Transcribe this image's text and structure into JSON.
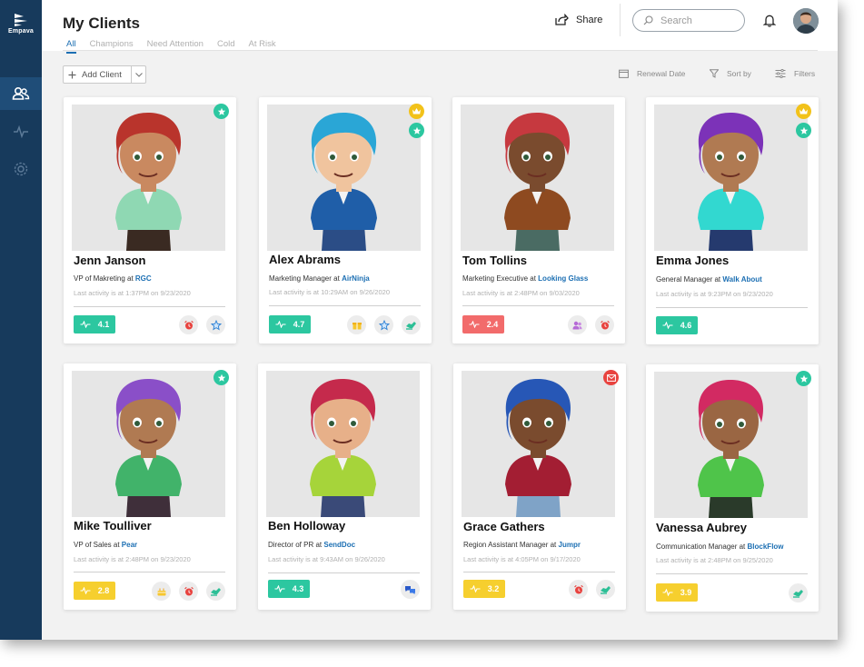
{
  "brand": {
    "name": "Empava"
  },
  "header": {
    "title": "My Clients",
    "tabs": [
      "All",
      "Champions",
      "Need Attention",
      "Cold",
      "At Risk"
    ],
    "share_label": "Share",
    "search_placeholder": "Search"
  },
  "toolbar": {
    "add_label": "Add Client",
    "renewal_label": "Renewal Date",
    "sort_label": "Sort by",
    "filters_label": "Filters"
  },
  "colors": {
    "sidebar": "#173a5c",
    "accent": "#1c6fb3",
    "score_green": "#2cc7a0",
    "score_red": "#f26b6b",
    "score_yellow": "#f6cf2e"
  },
  "clients": [
    {
      "name": "Jenn Janson",
      "role": "VP of Makreting at",
      "company": "RGC",
      "activity": "Last activity is at 1:37PM on 9/23/2020",
      "score": "4.1",
      "status": "green",
      "badges": [
        "star-icon"
      ],
      "actions": [
        "alarm-icon",
        "star-outline-icon"
      ]
    },
    {
      "name": "Alex Abrams",
      "role": "Marketing Manager at",
      "company": "AirNinja",
      "activity": "Last activity is at 10:29AM on 9/26/2020",
      "score": "4.7",
      "status": "green",
      "badges": [
        "crown-icon",
        "star-icon"
      ],
      "actions": [
        "gift-icon",
        "star-outline-icon",
        "handshake-icon"
      ]
    },
    {
      "name": "Tom Tollins",
      "role": "Marketing Executive at",
      "company": "Looking Glass",
      "activity": "Last activity is at 2:48PM on 9/03/2020",
      "score": "2.4",
      "status": "red",
      "badges": [],
      "actions": [
        "people-icon",
        "alarm-icon"
      ]
    },
    {
      "name": "Emma Jones",
      "role": "General Manager at",
      "company": "Walk About",
      "activity": "Last activity is at 9:23PM on 9/23/2020",
      "score": "4.6",
      "status": "green",
      "badges": [
        "crown-icon",
        "star-icon"
      ],
      "actions": []
    },
    {
      "name": "Mike Toulliver",
      "role": "VP of Sales at",
      "company": "Pear",
      "activity": "Last activity is at 2:48PM on 9/23/2020",
      "score": "2.8",
      "status": "yellow",
      "badges": [
        "star-icon"
      ],
      "actions": [
        "cake-icon",
        "alarm-icon",
        "handshake-icon"
      ]
    },
    {
      "name": "Ben Holloway",
      "role": "Director of PR at",
      "company": "SendDoc",
      "activity": "Last activity is at 9:43AM on 9/26/2020",
      "score": "4.3",
      "status": "green",
      "badges": [],
      "actions": [
        "chat-icon"
      ]
    },
    {
      "name": "Grace Gathers",
      "role": "Region Assistant Manager at",
      "company": "Jumpr",
      "activity": "Last activity is at 4:05PM on 9/17/2020",
      "score": "3.2",
      "status": "yellow",
      "badges": [
        "mail-icon"
      ],
      "actions": [
        "alarm-icon",
        "handshake-icon"
      ]
    },
    {
      "name": "Vanessa Aubrey",
      "role": "Communication Manager at",
      "company": "BlockFlow",
      "activity": "Last activity is at 2:48PM on 9/25/2020",
      "score": "3.9",
      "status": "yellow",
      "badges": [
        "star-icon"
      ],
      "actions": [
        "handshake-icon"
      ]
    }
  ]
}
